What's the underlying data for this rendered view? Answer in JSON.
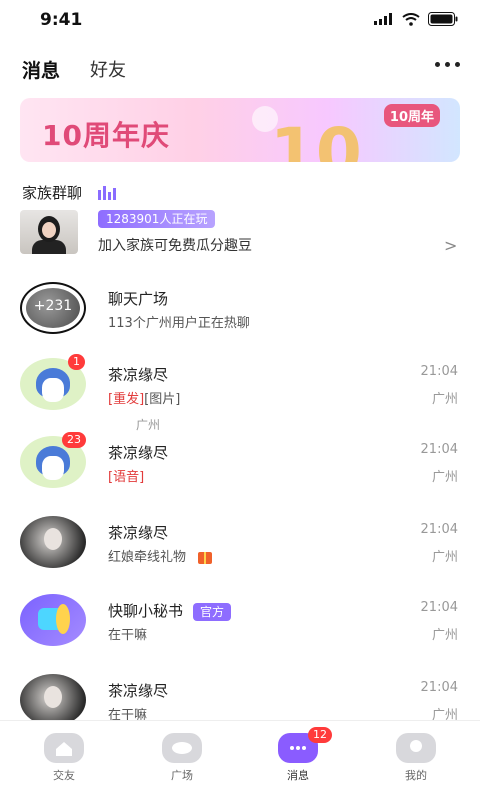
{
  "status_bar": {
    "time": "9:41"
  },
  "header": {
    "tabs": [
      {
        "label": "消息",
        "active": true
      },
      {
        "label": "好友",
        "active": false
      }
    ]
  },
  "banner": {
    "title": "10周年庆",
    "big_number": "10",
    "badge": "10周年"
  },
  "family_group": {
    "title": "家族群聊",
    "playing_count": "1283901人正在玩",
    "description": "加入家族可免费瓜分趣豆"
  },
  "chat_plaza": {
    "avatar_count": "+231",
    "name": "聊天广场",
    "subtitle": "113个广州用户正在热聊"
  },
  "conversations": [
    {
      "name": "茶凉缘尽",
      "time": "21:04",
      "location": "广州",
      "badge": "1",
      "tag": "[重发]",
      "message": "[图片]",
      "extra_location": "广州"
    },
    {
      "name": "茶凉缘尽",
      "time": "21:04",
      "location": "广州",
      "badge": "23",
      "tag": "[语音]",
      "message": ""
    },
    {
      "name": "茶凉缘尽",
      "time": "21:04",
      "location": "广州",
      "message": "红娘牵线礼物"
    },
    {
      "name": "快聊小秘书",
      "official": "官方",
      "time": "21:04",
      "location": "广州",
      "message": "在干嘛"
    },
    {
      "name": "茶凉缘尽",
      "time": "21:04",
      "location": "广州",
      "message": "在干嘛"
    }
  ],
  "bottom_nav": {
    "items": [
      {
        "label": "交友"
      },
      {
        "label": "广场"
      },
      {
        "label": "消息",
        "badge": "12",
        "active": true
      },
      {
        "label": "我的"
      }
    ]
  },
  "colors": {
    "accent": "#8a5cff",
    "badge_red": "#ff3b3b",
    "gift_orange": "#f08a2a"
  }
}
